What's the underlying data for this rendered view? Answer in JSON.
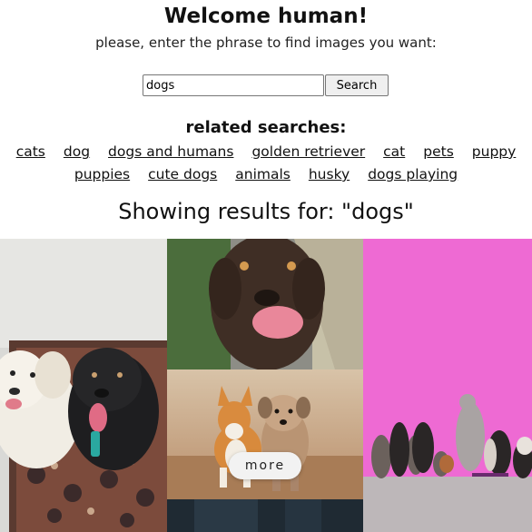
{
  "header": {
    "title": "Welcome human!",
    "subtitle": "please, enter the phrase to find images you want:"
  },
  "search": {
    "value": "dogs",
    "button_label": "Search"
  },
  "related": {
    "heading": "related searches:",
    "row1": [
      "cats",
      "dog",
      "dogs and humans",
      "golden retriever",
      "cat",
      "pets",
      "puppy"
    ],
    "row2": [
      "puppies",
      "cute dogs",
      "animals",
      "husky",
      "dogs playing"
    ]
  },
  "results": {
    "heading": "Showing results for: \"dogs\""
  },
  "gallery": {
    "more_label": "more",
    "photos": [
      {
        "name": "photo-two-dogs-on-rug",
        "subject": "white and black dogs sitting on patterned rug"
      },
      {
        "name": "photo-brown-dog-licking",
        "subject": "brown dog licking nose on road"
      },
      {
        "name": "photo-pink-wall-dogs",
        "subject": "row of dogs in front of pink wall"
      },
      {
        "name": "photo-corgi-and-terrier",
        "subject": "corgi and terrier running"
      },
      {
        "name": "photo-dark-partial",
        "subject": "partially visible dark photo"
      }
    ]
  },
  "colors": {
    "pink_wall": "#ee6ad3",
    "more_button_bg": "#f2f2f2"
  }
}
